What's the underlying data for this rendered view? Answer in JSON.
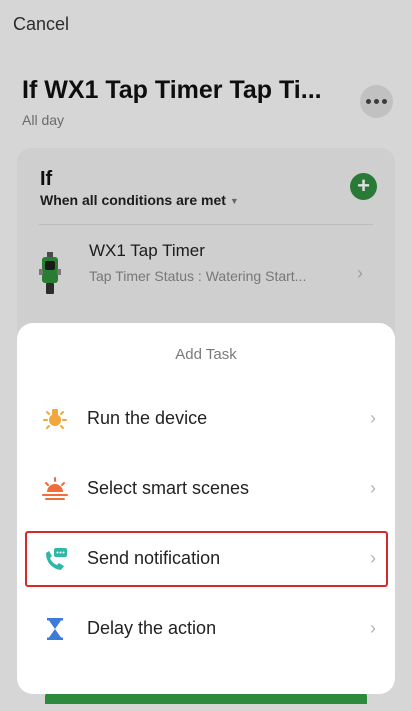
{
  "header": {
    "cancel_label": "Cancel",
    "title": "If WX1 Tap Timer Tap Ti...",
    "subtitle": "All day",
    "more_icon": "more-horizontal-icon"
  },
  "condition_card": {
    "title": "If",
    "condition_mode": "When all conditions are met",
    "add_icon": "plus-icon",
    "device": {
      "name": "WX1 Tap Timer",
      "status": "Tap Timer Status : Watering Start..."
    }
  },
  "add_task_sheet": {
    "title": "Add Task",
    "options": [
      {
        "label": "Run the device",
        "icon": "light-bulb-icon"
      },
      {
        "label": "Select smart scenes",
        "icon": "sunrise-icon"
      },
      {
        "label": "Send notification",
        "icon": "phone-chat-icon",
        "highlighted": true
      },
      {
        "label": "Delay the action",
        "icon": "hourglass-icon"
      }
    ]
  },
  "colors": {
    "accent_green": "#2e8b3e",
    "highlight_border": "#d42a2a",
    "bulb_orange": "#f2a73b",
    "sunrise_orange": "#f26b3a",
    "notify_teal": "#2fb8a6",
    "hourglass_blue": "#3d7bd9"
  }
}
